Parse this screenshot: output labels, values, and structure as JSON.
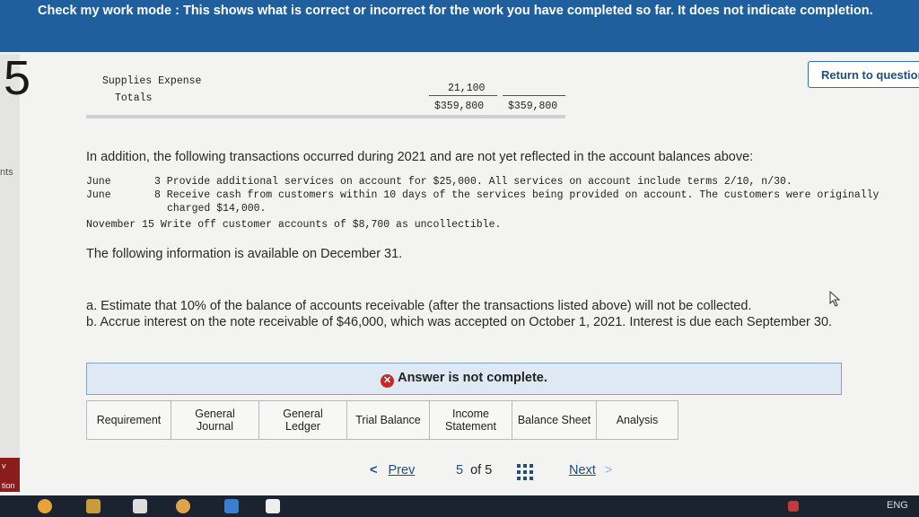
{
  "banner": {
    "text": "Check my work mode : This shows what is correct or incorrect for the work you have completed so far. It does not indicate completion."
  },
  "question_number": "5",
  "return_button": "Return to question",
  "left_strip": {
    "points_label": "nts",
    "bottom_label": "tion"
  },
  "trial_balance": {
    "supplies_label": "Supplies Expense",
    "supplies_amount": "21,100",
    "totals_label": "Totals",
    "debit_total": "$359,800",
    "credit_total": "$359,800"
  },
  "intro": "In addition, the following transactions occurred during 2021 and are not yet reflected in the account balances above:",
  "transactions": {
    "t1_month": "June",
    "t1_text": "3 Provide additional services on account for $25,000. All services on account include terms 2/10, n/30.",
    "t2_month": "June",
    "t2_text": "8 Receive cash from customers within 10 days of the services being provided on account. The customers were originally",
    "t2_cont": "charged $14,000.",
    "t3_text": "November 15 Write off customer accounts of $8,700 as uncollectible."
  },
  "info_heading": "The following information is available on December 31.",
  "items": {
    "a": "a. Estimate that 10% of the balance of accounts receivable (after the transactions listed above) will not be collected.",
    "b": "b. Accrue interest on the note receivable of $46,000, which was accepted on October 1, 2021. Interest is due each September 30."
  },
  "answer_status": "Answer is not complete.",
  "tabs": [
    {
      "line1": "Requirement",
      "line2": ""
    },
    {
      "line1": "General",
      "line2": "Journal"
    },
    {
      "line1": "General",
      "line2": "Ledger"
    },
    {
      "line1": "Trial Balance",
      "line2": ""
    },
    {
      "line1": "Income",
      "line2": "Statement"
    },
    {
      "line1": "Balance Sheet",
      "line2": ""
    },
    {
      "line1": "Analysis",
      "line2": ""
    }
  ],
  "pagination": {
    "prev": "Prev",
    "current": "5",
    "of_label": "of 5",
    "next": "Next"
  },
  "taskbar": {
    "language": "ENG"
  },
  "colors": {
    "banner": "#1f5f9e",
    "answer_bar": "#dfe9f3",
    "error": "#c62828",
    "link": "#1f4f7f"
  }
}
